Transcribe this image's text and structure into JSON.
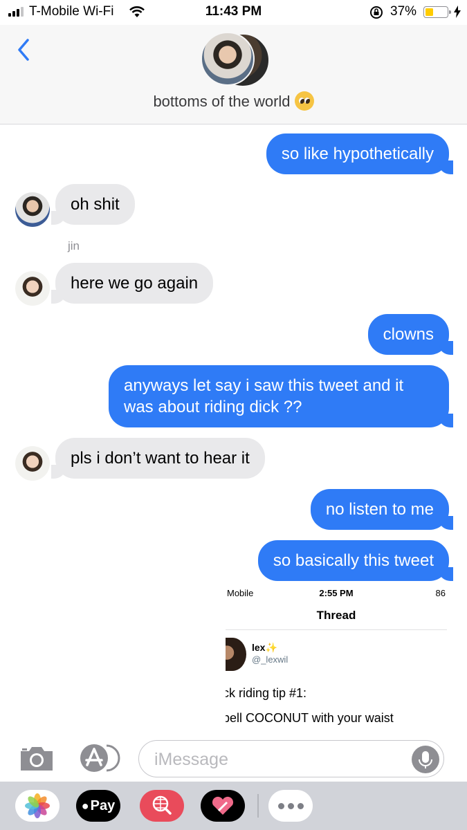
{
  "status_bar": {
    "carrier": "T-Mobile Wi-Fi",
    "time": "11:43 PM",
    "battery_percent": "37%",
    "battery_level": 0.37,
    "icons": [
      "signal-icon",
      "wifi-icon",
      "orientation-lock-icon",
      "battery-icon",
      "charging-bolt-icon"
    ]
  },
  "header": {
    "back_icon": "chevron-left-icon",
    "thread_title": "bottoms of the world",
    "title_emoji": "pleading-face-emoji"
  },
  "messages": [
    {
      "direction": "out",
      "text": "so like hypothetically"
    },
    {
      "direction": "in",
      "text": "oh shit"
    },
    {
      "direction": "in",
      "sender": "jin",
      "text": "here we go again"
    },
    {
      "direction": "out",
      "text": "clowns"
    },
    {
      "direction": "out",
      "text": "anyways let say i saw this tweet and it was about riding dick ??"
    },
    {
      "direction": "in",
      "text": "pls i don’t want to hear it"
    },
    {
      "direction": "out",
      "text": "no listen to me"
    },
    {
      "direction": "out",
      "text": "so basically this tweet"
    }
  ],
  "attachment": {
    "carrier": "Mobile",
    "time": "2:55 PM",
    "battery": "86",
    "title": "Thread",
    "author_name": "lex✨",
    "author_handle": "@_lexwil",
    "line1": "ck riding tip #1:",
    "line2": "bell COCONUT with your waist"
  },
  "compose": {
    "placeholder": "iMessage",
    "icons": [
      "camera-icon",
      "app-store-icon",
      "microphone-icon"
    ]
  },
  "app_drawer": {
    "apps": [
      "photos",
      "Pay",
      "image-search",
      "digital-touch",
      "more"
    ],
    "pay_label": "Pay",
    "colors": {
      "search": "#e94b5b",
      "pay": "#000000"
    }
  },
  "colors": {
    "outgoing": "#2f7bf6",
    "incoming": "#e9e9eb",
    "accent": "#2f7bf6"
  }
}
